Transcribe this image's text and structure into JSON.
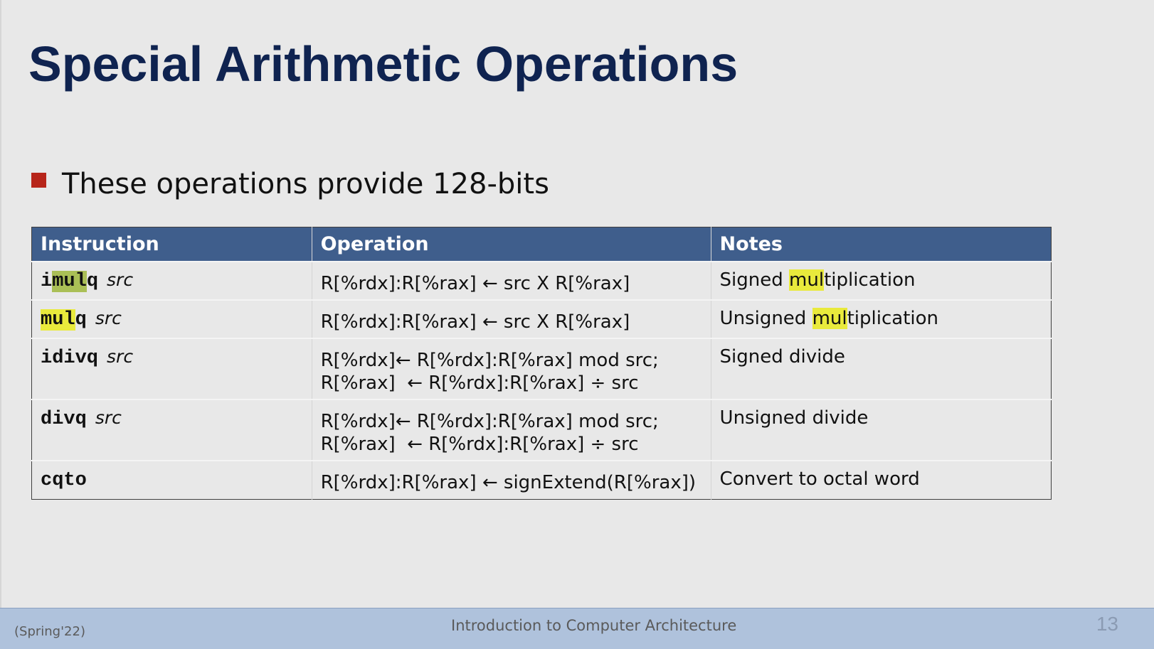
{
  "slide": {
    "title": "Special Arithmetic Operations",
    "bullet": "These operations provide 128-bits"
  },
  "table": {
    "headers": [
      "Instruction",
      "Operation",
      "Notes"
    ],
    "rows": [
      {
        "instr_pre": "i",
        "instr_hl": "mul",
        "instr_post": "q",
        "hl_color": "green",
        "operand": "src",
        "op_line1": "R[%rdx]:R[%rax] ← src X R[%rax]",
        "op_line2": "",
        "note_pre": "Signed ",
        "note_hl": "mul",
        "note_post": "tiplication"
      },
      {
        "instr_pre": "",
        "instr_hl": "mul",
        "instr_post": "q",
        "hl_color": "yellow",
        "operand": "src",
        "op_line1": "R[%rdx]:R[%rax] ← src X R[%rax]",
        "op_line2": "",
        "note_pre": "Unsigned ",
        "note_hl": "mul",
        "note_post": "tiplication"
      },
      {
        "instr_pre": "idivq",
        "instr_hl": "",
        "instr_post": "",
        "hl_color": "",
        "operand": "src",
        "op_line1": "R[%rdx]← R[%rdx]:R[%rax] mod src;",
        "op_line2": "R[%rax]  ← R[%rdx]:R[%rax] ÷ src",
        "note_pre": "Signed divide",
        "note_hl": "",
        "note_post": ""
      },
      {
        "instr_pre": "divq",
        "instr_hl": "",
        "instr_post": "",
        "hl_color": "",
        "operand": "src",
        "op_line1": "R[%rdx]← R[%rdx]:R[%rax] mod src;",
        "op_line2": "R[%rax]  ← R[%rdx]:R[%rax] ÷ src",
        "note_pre": "Unsigned divide",
        "note_hl": "",
        "note_post": ""
      },
      {
        "instr_pre": "cqto",
        "instr_hl": "",
        "instr_post": "",
        "hl_color": "",
        "operand": "",
        "op_line1": "R[%rdx]:R[%rax] ← signExtend(R[%rax])",
        "op_line2": "",
        "note_pre": "Convert to octal word",
        "note_hl": "",
        "note_post": ""
      }
    ]
  },
  "footer": {
    "term": "(Spring'22)",
    "course": "Introduction to Computer Architecture",
    "page_number": "13"
  },
  "colors": {
    "title": "#0f2350",
    "header_bg": "#3f5e8c",
    "bullet": "#b7251a",
    "highlight_green": "#aabf56",
    "highlight_yellow": "#e9ea3c",
    "footer_bg": "#afc2dc"
  }
}
